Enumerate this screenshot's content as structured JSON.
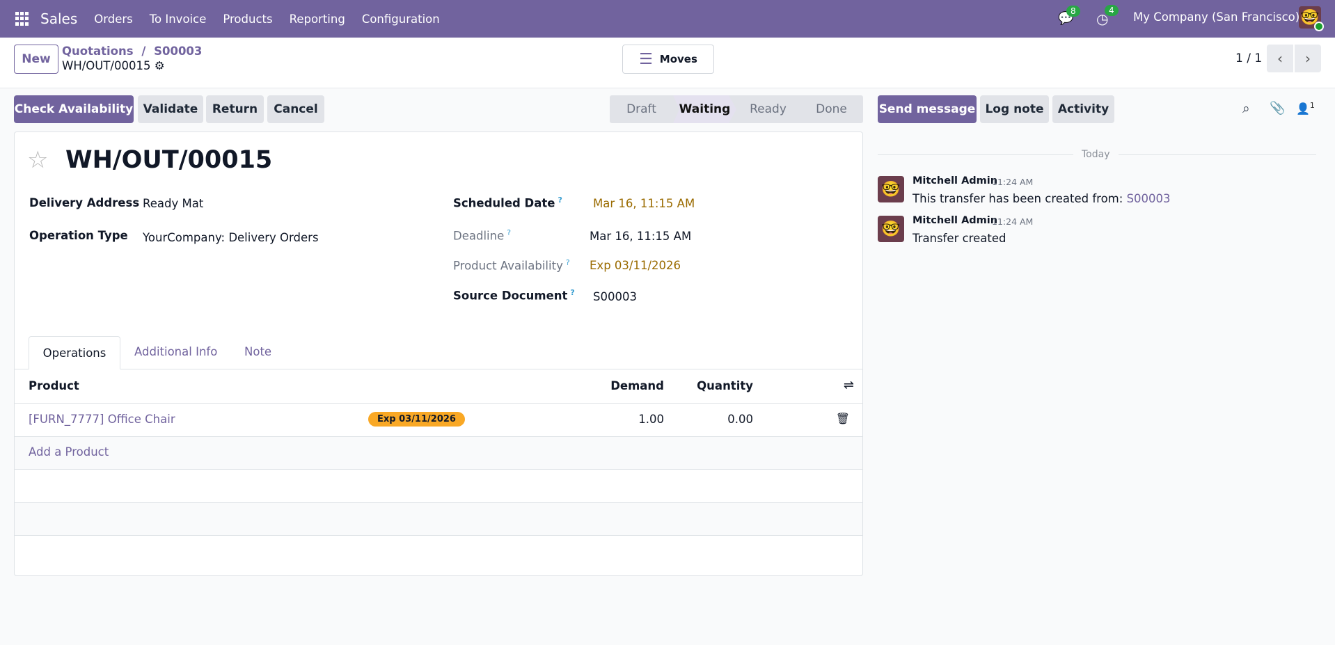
{
  "navbar": {
    "app": "Sales",
    "menus": [
      "Orders",
      "To Invoice",
      "Products",
      "Reporting",
      "Configuration"
    ],
    "messages_count": "8",
    "activities_count": "4",
    "company": "My Company (San Francisco)"
  },
  "control_panel": {
    "new_label": "New",
    "breadcrumb": [
      "Quotations",
      "S00003"
    ],
    "record": "WH/OUT/00015",
    "moves_label": "Moves",
    "pager": "1 / 1"
  },
  "actions": {
    "check_availability": "Check Availability",
    "validate": "Validate",
    "return": "Return",
    "cancel": "Cancel"
  },
  "statusbar": [
    "Draft",
    "Waiting",
    "Ready",
    "Done"
  ],
  "statusbar_active": "Waiting",
  "form": {
    "title": "WH/OUT/00015",
    "left_fields": [
      {
        "label": "Delivery Address",
        "value": "Ready Mat"
      },
      {
        "label": "Operation Type",
        "value": "YourCompany: Delivery Orders"
      }
    ],
    "right_fields": [
      {
        "label": "Scheduled Date",
        "value": "Mar 16, 11:15 AM"
      },
      {
        "label": "Deadline",
        "value": "Mar 16, 11:15 AM"
      },
      {
        "label": "Product Availability",
        "value": "Exp 03/11/2026"
      },
      {
        "label": "Source Document",
        "value": "S00003"
      }
    ],
    "help_mark": "?",
    "tabs": [
      "Operations",
      "Additional Info",
      "Note"
    ],
    "table": {
      "headers": [
        "Product",
        "Demand",
        "Quantity"
      ],
      "rows": [
        {
          "product": "[FURN_7777] Office Chair",
          "badge": "Exp 03/11/2026",
          "demand": "1.00",
          "quantity": "0.00"
        }
      ],
      "add_label": "Add a Product"
    }
  },
  "chatter": {
    "send_message": "Send message",
    "log_note": "Log note",
    "activity": "Activity",
    "followers": "1",
    "date_sep": "Today",
    "messages": [
      {
        "author": "Mitchell Admin",
        "time": "11:24 AM",
        "text": "This transfer has been created from:",
        "link": "S00003"
      },
      {
        "author": "Mitchell Admin",
        "time": "11:24 AM",
        "text": "Transfer created"
      }
    ]
  },
  "colors": {
    "brand": "#71639e",
    "badge": "#f9a825",
    "success": "#28a745"
  }
}
